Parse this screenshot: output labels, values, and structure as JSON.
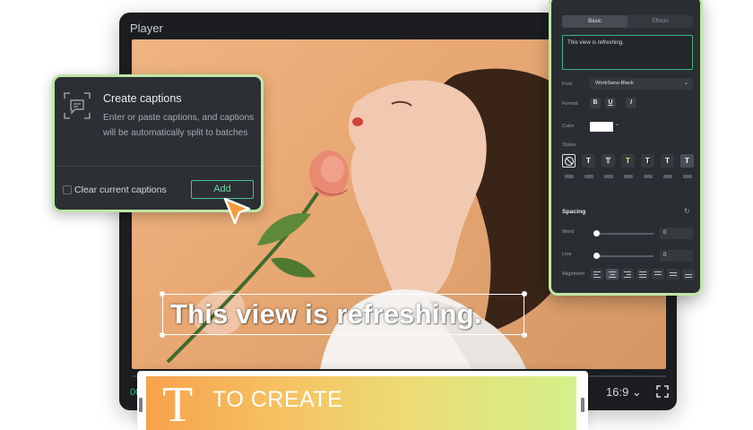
{
  "player": {
    "title": "Player",
    "caption": "This view is refreshing.",
    "timecode": "00",
    "aspect_ratio": "16:9 ⌄"
  },
  "create_captions": {
    "title": "Create captions",
    "description": "Enter or paste captions, and captions will be automatically split to batches",
    "clear_label": "Clear current captions",
    "add_label": "Add"
  },
  "panel": {
    "tabs": [
      "Basic",
      "Effects"
    ],
    "text_value": "This view is refreshing.",
    "font_label": "Font",
    "font_value": "WorkSans-Black",
    "format_label": "Format",
    "format_buttons": [
      "B",
      "U",
      "I"
    ],
    "color_label": "Color",
    "color_value": "#ffffff",
    "styles_label": "Styles",
    "spacing_label": "Spacing",
    "word_label": "Word",
    "word_value": "0",
    "line_label": "Line",
    "line_value": "0",
    "alignment_label": "Alignment"
  },
  "banner": {
    "letter": "T",
    "text": "TO CREATE"
  },
  "colors": {
    "accent_green": "#46c28e",
    "highlight_border": "#bfe7a6",
    "dark_panel": "#2a2d31"
  }
}
